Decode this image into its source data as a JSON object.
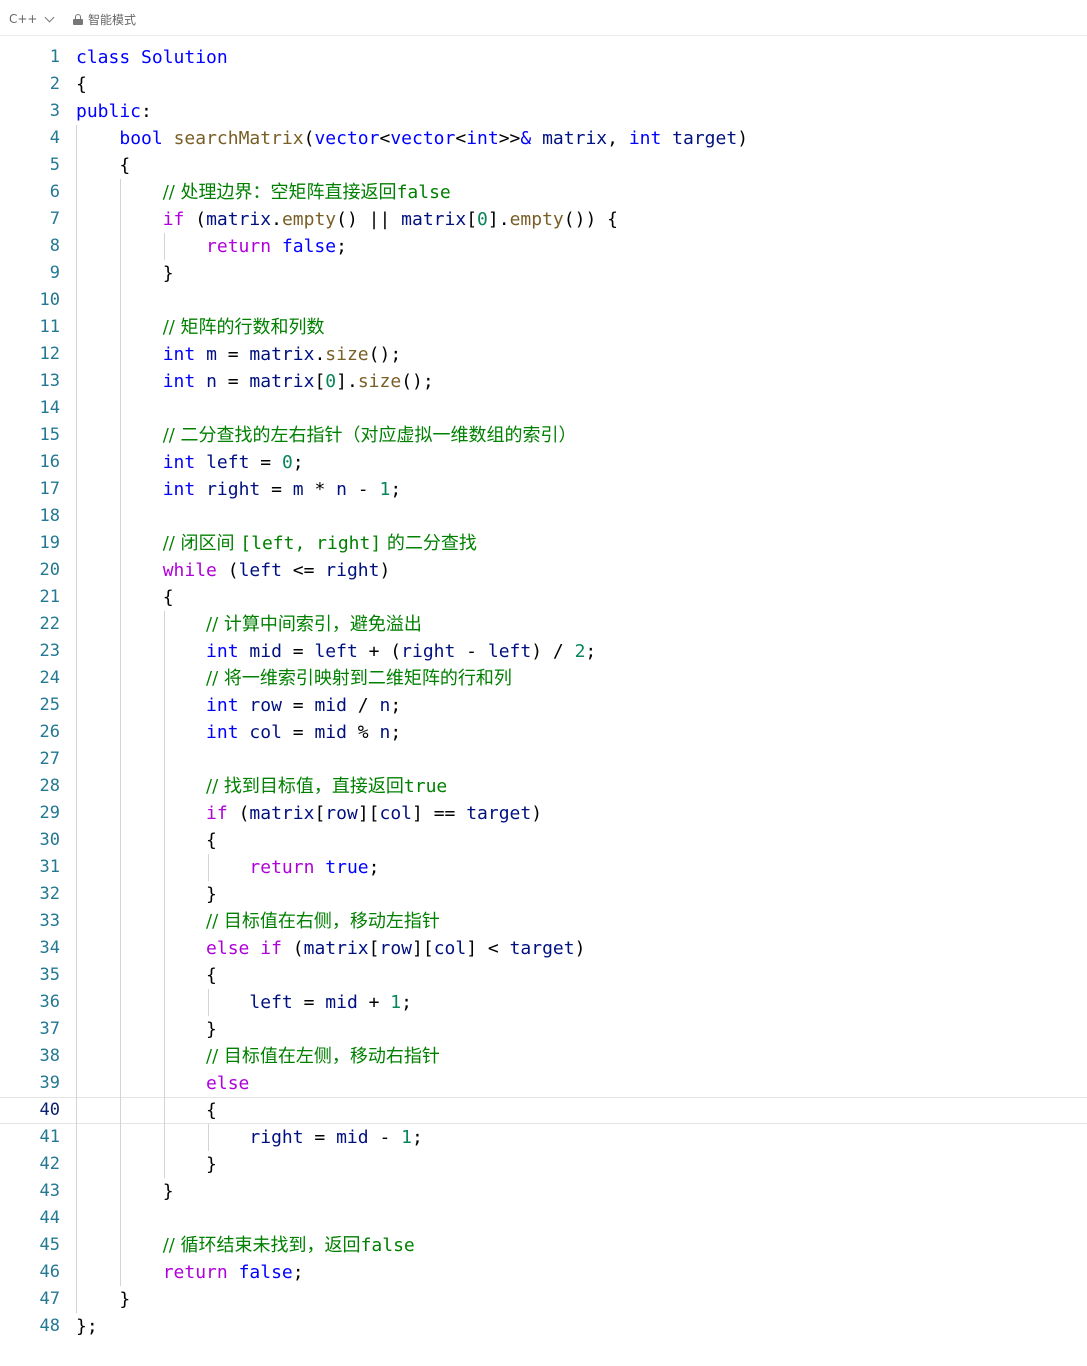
{
  "toolbar": {
    "language": "C++",
    "mode": "智能模式"
  },
  "editor": {
    "active_line": 40,
    "colors": {
      "keyword": "#0000ff",
      "type": "#0000ff",
      "function": "#795e26",
      "variable": "#001080",
      "comment": "#008000",
      "number": "#098658",
      "control": "#af00db",
      "line_number": "#237893",
      "guide": "#d3d3d3"
    },
    "lines": [
      {
        "n": "1",
        "t": [
          [
            "class",
            "kw"
          ],
          [
            " "
          ],
          [
            "Solution",
            "cls"
          ]
        ]
      },
      {
        "n": "2",
        "t": [
          [
            "{"
          ]
        ]
      },
      {
        "n": "3",
        "t": [
          [
            "public",
            "kw"
          ],
          [
            ":"
          ]
        ]
      },
      {
        "n": "4",
        "t": [
          [
            "    "
          ],
          [
            "bool",
            "kw"
          ],
          [
            " "
          ],
          [
            "searchMatrix",
            "fn"
          ],
          [
            "("
          ],
          [
            "vector",
            "cls"
          ],
          [
            "<"
          ],
          [
            "vector",
            "cls"
          ],
          [
            "<"
          ],
          [
            "int",
            "kw"
          ],
          [
            ">>"
          ],
          [
            "&",
            "kw"
          ],
          [
            " "
          ],
          [
            "matrix",
            "var"
          ],
          [
            ", "
          ],
          [
            "int",
            "kw"
          ],
          [
            " "
          ],
          [
            "target",
            "var"
          ],
          [
            ")"
          ]
        ]
      },
      {
        "n": "5",
        "t": [
          [
            "    {"
          ]
        ]
      },
      {
        "n": "6",
        "t": [
          [
            "        "
          ],
          [
            "// 处理边界：空矩阵直接返回",
            "cmt"
          ],
          [
            "false",
            "cmtb"
          ]
        ]
      },
      {
        "n": "7",
        "t": [
          [
            "        "
          ],
          [
            "if",
            "ctl"
          ],
          [
            " ("
          ],
          [
            "matrix",
            "var"
          ],
          [
            "."
          ],
          [
            "empty",
            "fn"
          ],
          [
            "() || "
          ],
          [
            "matrix",
            "var"
          ],
          [
            "["
          ],
          [
            "0",
            "num"
          ],
          [
            "]."
          ],
          [
            "empty",
            "fn"
          ],
          [
            "()) {"
          ]
        ]
      },
      {
        "n": "8",
        "t": [
          [
            "            "
          ],
          [
            "return",
            "ctl"
          ],
          [
            " "
          ],
          [
            "false",
            "kw"
          ],
          [
            ";"
          ]
        ]
      },
      {
        "n": "9",
        "t": [
          [
            "        }"
          ]
        ]
      },
      {
        "n": "10",
        "t": []
      },
      {
        "n": "11",
        "t": [
          [
            "        "
          ],
          [
            "// 矩阵的行数和列数",
            "cmt"
          ]
        ]
      },
      {
        "n": "12",
        "t": [
          [
            "        "
          ],
          [
            "int",
            "kw"
          ],
          [
            " "
          ],
          [
            "m",
            "var"
          ],
          [
            " = "
          ],
          [
            "matrix",
            "var"
          ],
          [
            "."
          ],
          [
            "size",
            "fn"
          ],
          [
            "();"
          ]
        ]
      },
      {
        "n": "13",
        "t": [
          [
            "        "
          ],
          [
            "int",
            "kw"
          ],
          [
            " "
          ],
          [
            "n",
            "var"
          ],
          [
            " = "
          ],
          [
            "matrix",
            "var"
          ],
          [
            "["
          ],
          [
            "0",
            "num"
          ],
          [
            "]."
          ],
          [
            "size",
            "fn"
          ],
          [
            "();"
          ]
        ]
      },
      {
        "n": "14",
        "t": []
      },
      {
        "n": "15",
        "t": [
          [
            "        "
          ],
          [
            "// 二分查找的左右指针（对应虚拟一维数组的索引）",
            "cmt"
          ]
        ]
      },
      {
        "n": "16",
        "t": [
          [
            "        "
          ],
          [
            "int",
            "kw"
          ],
          [
            " "
          ],
          [
            "left",
            "var"
          ],
          [
            " = "
          ],
          [
            "0",
            "num"
          ],
          [
            ";"
          ]
        ]
      },
      {
        "n": "17",
        "t": [
          [
            "        "
          ],
          [
            "int",
            "kw"
          ],
          [
            " "
          ],
          [
            "right",
            "var"
          ],
          [
            " = "
          ],
          [
            "m",
            "var"
          ],
          [
            " * "
          ],
          [
            "n",
            "var"
          ],
          [
            " - "
          ],
          [
            "1",
            "num"
          ],
          [
            ";"
          ]
        ]
      },
      {
        "n": "18",
        "t": []
      },
      {
        "n": "19",
        "t": [
          [
            "        "
          ],
          [
            "// 闭区间 ",
            "cmt"
          ],
          [
            "[left, right]",
            "cmtb"
          ],
          [
            " 的二分查找",
            "cmt"
          ]
        ]
      },
      {
        "n": "20",
        "t": [
          [
            "        "
          ],
          [
            "while",
            "ctl"
          ],
          [
            " ("
          ],
          [
            "left",
            "var"
          ],
          [
            " <= "
          ],
          [
            "right",
            "var"
          ],
          [
            ")"
          ]
        ]
      },
      {
        "n": "21",
        "t": [
          [
            "        {"
          ]
        ]
      },
      {
        "n": "22",
        "t": [
          [
            "            "
          ],
          [
            "// 计算中间索引，避免溢出",
            "cmt"
          ]
        ]
      },
      {
        "n": "23",
        "t": [
          [
            "            "
          ],
          [
            "int",
            "kw"
          ],
          [
            " "
          ],
          [
            "mid",
            "var"
          ],
          [
            " = "
          ],
          [
            "left",
            "var"
          ],
          [
            " + ("
          ],
          [
            "right",
            "var"
          ],
          [
            " - "
          ],
          [
            "left",
            "var"
          ],
          [
            ") / "
          ],
          [
            "2",
            "num"
          ],
          [
            ";"
          ]
        ]
      },
      {
        "n": "24",
        "t": [
          [
            "            "
          ],
          [
            "// 将一维索引映射到二维矩阵的行和列",
            "cmt"
          ]
        ]
      },
      {
        "n": "25",
        "t": [
          [
            "            "
          ],
          [
            "int",
            "kw"
          ],
          [
            " "
          ],
          [
            "row",
            "var"
          ],
          [
            " = "
          ],
          [
            "mid",
            "var"
          ],
          [
            " / "
          ],
          [
            "n",
            "var"
          ],
          [
            ";"
          ]
        ]
      },
      {
        "n": "26",
        "t": [
          [
            "            "
          ],
          [
            "int",
            "kw"
          ],
          [
            " "
          ],
          [
            "col",
            "var"
          ],
          [
            " = "
          ],
          [
            "mid",
            "var"
          ],
          [
            " % "
          ],
          [
            "n",
            "var"
          ],
          [
            ";"
          ]
        ]
      },
      {
        "n": "27",
        "t": []
      },
      {
        "n": "28",
        "t": [
          [
            "            "
          ],
          [
            "// 找到目标值，直接返回",
            "cmt"
          ],
          [
            "true",
            "cmtb"
          ]
        ]
      },
      {
        "n": "29",
        "t": [
          [
            "            "
          ],
          [
            "if",
            "ctl"
          ],
          [
            " ("
          ],
          [
            "matrix",
            "var"
          ],
          [
            "["
          ],
          [
            "row",
            "var"
          ],
          [
            "]["
          ],
          [
            "col",
            "var"
          ],
          [
            "] == "
          ],
          [
            "target",
            "var"
          ],
          [
            ")"
          ]
        ]
      },
      {
        "n": "30",
        "t": [
          [
            "            {"
          ]
        ]
      },
      {
        "n": "31",
        "t": [
          [
            "                "
          ],
          [
            "return",
            "ctl"
          ],
          [
            " "
          ],
          [
            "true",
            "kw"
          ],
          [
            ";"
          ]
        ]
      },
      {
        "n": "32",
        "t": [
          [
            "            }"
          ]
        ]
      },
      {
        "n": "33",
        "t": [
          [
            "            "
          ],
          [
            "// 目标值在右侧，移动左指针",
            "cmt"
          ]
        ]
      },
      {
        "n": "34",
        "t": [
          [
            "            "
          ],
          [
            "else",
            "ctl"
          ],
          [
            " "
          ],
          [
            "if",
            "ctl"
          ],
          [
            " ("
          ],
          [
            "matrix",
            "var"
          ],
          [
            "["
          ],
          [
            "row",
            "var"
          ],
          [
            "]["
          ],
          [
            "col",
            "var"
          ],
          [
            "] < "
          ],
          [
            "target",
            "var"
          ],
          [
            ")"
          ]
        ]
      },
      {
        "n": "35",
        "t": [
          [
            "            {"
          ]
        ]
      },
      {
        "n": "36",
        "t": [
          [
            "                "
          ],
          [
            "left",
            "var"
          ],
          [
            " = "
          ],
          [
            "mid",
            "var"
          ],
          [
            " + "
          ],
          [
            "1",
            "num"
          ],
          [
            ";"
          ]
        ]
      },
      {
        "n": "37",
        "t": [
          [
            "            }"
          ]
        ]
      },
      {
        "n": "38",
        "t": [
          [
            "            "
          ],
          [
            "// 目标值在左侧，移动右指针",
            "cmt"
          ]
        ]
      },
      {
        "n": "39",
        "t": [
          [
            "            "
          ],
          [
            "else",
            "ctl"
          ]
        ]
      },
      {
        "n": "40",
        "t": [
          [
            "            {"
          ]
        ]
      },
      {
        "n": "41",
        "t": [
          [
            "                "
          ],
          [
            "right",
            "var"
          ],
          [
            " = "
          ],
          [
            "mid",
            "var"
          ],
          [
            " - "
          ],
          [
            "1",
            "num"
          ],
          [
            ";"
          ]
        ]
      },
      {
        "n": "42",
        "t": [
          [
            "            }"
          ]
        ]
      },
      {
        "n": "43",
        "t": [
          [
            "        }"
          ]
        ]
      },
      {
        "n": "44",
        "t": []
      },
      {
        "n": "45",
        "t": [
          [
            "        "
          ],
          [
            "// 循环结束未找到，返回",
            "cmt"
          ],
          [
            "false",
            "cmtb"
          ]
        ]
      },
      {
        "n": "46",
        "t": [
          [
            "        "
          ],
          [
            "return",
            "ctl"
          ],
          [
            " "
          ],
          [
            "false",
            "kw"
          ],
          [
            ";"
          ]
        ]
      },
      {
        "n": "47",
        "t": [
          [
            "    }"
          ]
        ]
      },
      {
        "n": "48",
        "t": [
          [
            "};"
          ]
        ]
      }
    ]
  }
}
